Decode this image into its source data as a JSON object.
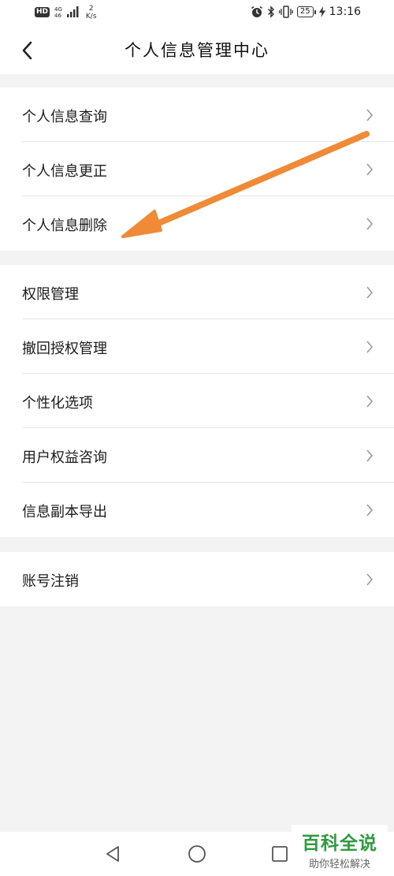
{
  "status_bar": {
    "hd": "HD",
    "network": "4G",
    "network_sub": "46",
    "speed_value": "2",
    "speed_unit": "K/s",
    "battery": "25",
    "time": "13:16"
  },
  "header": {
    "title": "个人信息管理中心"
  },
  "groups": [
    {
      "items": [
        {
          "label": "个人信息查询"
        },
        {
          "label": "个人信息更正"
        },
        {
          "label": "个人信息删除"
        }
      ]
    },
    {
      "items": [
        {
          "label": "权限管理"
        },
        {
          "label": "撤回授权管理"
        },
        {
          "label": "个性化选项"
        },
        {
          "label": "用户权益咨询"
        },
        {
          "label": "信息副本导出"
        }
      ]
    },
    {
      "items": [
        {
          "label": "账号注销"
        }
      ]
    }
  ],
  "watermark": {
    "title": "百科全说",
    "subtitle": "助你轻松解决"
  },
  "colors": {
    "arrow": "#f08a36",
    "watermark_green": "#2e9b3e",
    "background": "#f3f3f3"
  }
}
